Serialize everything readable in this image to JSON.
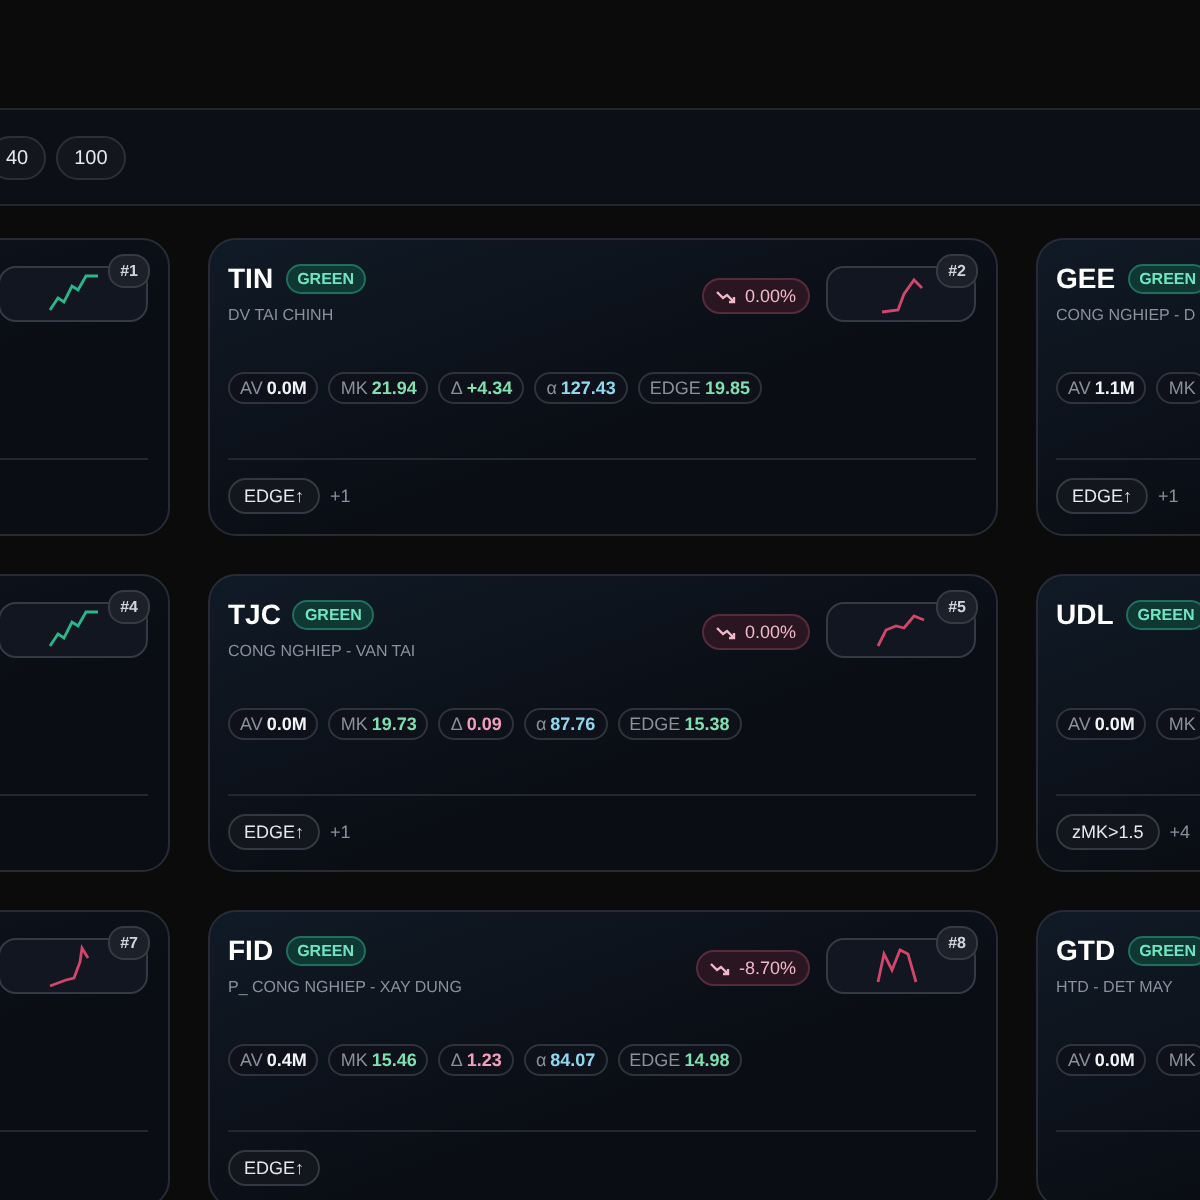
{
  "size_filter": {
    "options": [
      {
        "label": "40",
        "selected": false
      },
      {
        "label": "100",
        "selected": false
      }
    ]
  },
  "cards": [
    {
      "rank": "#1",
      "color": "#2bb58a"
    },
    {
      "ticker": "TIN",
      "tag": "GREEN",
      "sector": "DV TAI CHINH",
      "change": "0.00%",
      "color": "#d2466b",
      "rank": "#2",
      "metrics": [
        {
          "label": "AV",
          "value": "0.0M",
          "color": "#f2f4f8"
        },
        {
          "label": "MK",
          "value": "21.94",
          "color": "#7fe0b0"
        },
        {
          "label": "Δ",
          "value": "+4.34",
          "color": "#7fe0b0"
        },
        {
          "label": "α",
          "value": "127.43",
          "color": "#8fd8f0"
        },
        {
          "label": "EDGE",
          "value": "19.85",
          "color": "#7fe0b0"
        }
      ],
      "signals": [
        "EDGE↑"
      ],
      "more": "+1"
    },
    {
      "ticker": "GEE",
      "tag": "GREEN",
      "sector": "CONG NGHIEP - D",
      "metrics": [
        {
          "label": "AV",
          "value": "1.1M"
        },
        {
          "label": "MK"
        }
      ],
      "signals": [
        "EDGE↑"
      ],
      "more": "+1"
    },
    {
      "rank": "#4",
      "color": "#2bb58a"
    },
    {
      "ticker": "TJC",
      "tag": "GREEN",
      "sector": "CONG NGHIEP - VAN TAI",
      "change": "0.00%",
      "color": "#d2466b",
      "rank": "#5",
      "metrics": [
        {
          "label": "AV",
          "value": "0.0M",
          "color": "#f2f4f8"
        },
        {
          "label": "MK",
          "value": "19.73",
          "color": "#7fe0b0"
        },
        {
          "label": "Δ",
          "value": "0.09",
          "color": "#f0a0bb"
        },
        {
          "label": "α",
          "value": "87.76",
          "color": "#8fd8f0"
        },
        {
          "label": "EDGE",
          "value": "15.38",
          "color": "#7fe0b0"
        }
      ],
      "signals": [
        "EDGE↑"
      ],
      "more": "+1"
    },
    {
      "ticker": "UDL",
      "tag": "GREEN",
      "metrics": [
        {
          "label": "AV",
          "value": "0.0M"
        },
        {
          "label": "MK"
        }
      ],
      "signals": [
        "zMK>1.5"
      ],
      "more": "+4"
    },
    {
      "rank": "#7",
      "color": "#d2466b"
    },
    {
      "ticker": "FID",
      "tag": "GREEN",
      "sector": "P_ CONG NGHIEP - XAY DUNG",
      "change": "-8.70%",
      "color": "#d2466b",
      "rank": "#8",
      "metrics": [
        {
          "label": "AV",
          "value": "0.4M",
          "color": "#f2f4f8"
        },
        {
          "label": "MK",
          "value": "15.46",
          "color": "#7fe0b0"
        },
        {
          "label": "Δ",
          "value": "1.23",
          "color": "#f0a0bb"
        },
        {
          "label": "α",
          "value": "84.07",
          "color": "#8fd8f0"
        },
        {
          "label": "EDGE",
          "value": "14.98",
          "color": "#7fe0b0"
        }
      ],
      "signals": [
        "EDGE↑"
      ]
    },
    {
      "ticker": "GTD",
      "tag": "GREEN",
      "sector": "HTD - DET MAY",
      "metrics": [
        {
          "label": "AV",
          "value": "0.0M"
        },
        {
          "label": "MK"
        }
      ]
    }
  ]
}
